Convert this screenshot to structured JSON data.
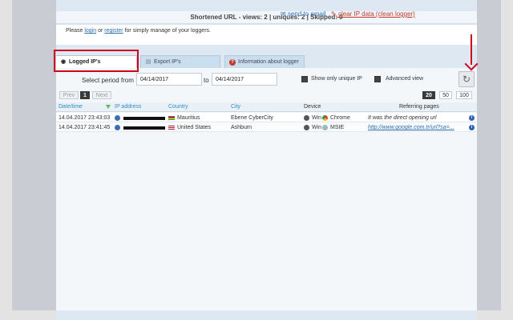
{
  "stats": "Shortened URL - views: 2 | uniques: 2 | Skipped: 0",
  "info": {
    "please": "Please",
    "login": "login",
    "or": "or",
    "register": "register",
    "suffix": "for simply manage of your loggers.",
    "send_email": "send to email",
    "clear_ip": "clear IP data (clean logger)"
  },
  "tabs": [
    {
      "label": "Logged IP's",
      "icon": "eye-icon"
    },
    {
      "label": "Export IP's",
      "icon": "export-icon"
    },
    {
      "label": "Information about logger",
      "icon": "help-icon"
    }
  ],
  "filters": {
    "period_label": "Select period from",
    "from_date": "04/14/2017",
    "to_label": "to",
    "to_date": "04/14/2017",
    "unique_ip_label": "Show only unique IP",
    "advanced_view_label": "Advanced view"
  },
  "pagination": {
    "prev": "Prev",
    "current": "1",
    "next": "Next",
    "sizes": [
      "20",
      "50",
      "100"
    ]
  },
  "table": {
    "headers": [
      "Date/time",
      "IP address",
      "Country",
      "City",
      "Device",
      "Referring pages"
    ],
    "rows": [
      {
        "datetime": "14.04.2017 23:43:03",
        "country": "Mauritius",
        "city": "Ebene CyberCity",
        "os": "Win",
        "browser": "Chrome",
        "referrer": "It was the direct opening url"
      },
      {
        "datetime": "14.04.2017 23:41:45",
        "country": "United States",
        "city": "Ashburn",
        "os": "Win",
        "browser": "MSIE",
        "referrer": "http://www.google.com.tr/url?sa=..."
      }
    ]
  },
  "colors": {
    "accent": "#2f8ec9",
    "highlight": "#d0021b",
    "panel_bg": "#dde8f3"
  }
}
